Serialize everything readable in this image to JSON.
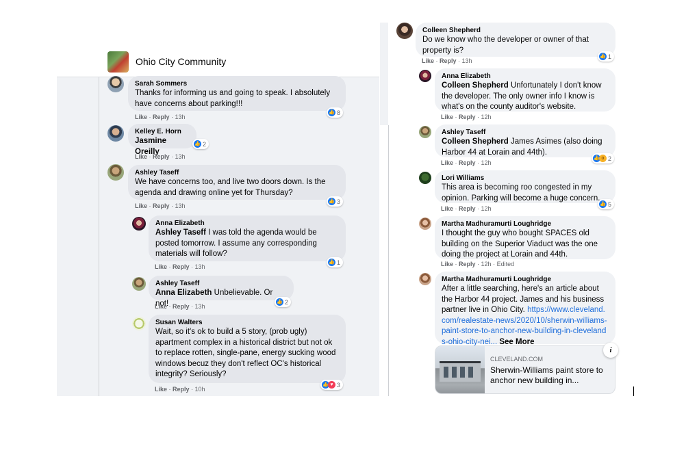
{
  "group": {
    "title": "Ohio City Community"
  },
  "left_comments": [
    {
      "author": "Sarah Sommers",
      "text": "Thanks for informing us and going to speak. I absolutely have concerns about parking!!!",
      "like": "Like",
      "reply": "Reply",
      "time": "13h",
      "reactions": "8"
    },
    {
      "author": "Kelley E. Horn",
      "tag": "Jasmine Oreilly",
      "like": "Like",
      "reply": "Reply",
      "time": "13h",
      "reactions": "2"
    },
    {
      "author": "Ashley Taseff",
      "text": "We have concerns too, and live two doors down. Is the agenda and drawing online yet for Thursday?",
      "like": "Like",
      "reply": "Reply",
      "time": "13h",
      "reactions": "3"
    },
    {
      "author": "Anna Elizabeth",
      "tag": "Ashley Taseff",
      "text": " I was told the agenda would be posted tomorrow. I assume any corresponding materials will follow?",
      "like": "Like",
      "reply": "Reply",
      "time": "13h",
      "reactions": "1"
    },
    {
      "author": "Ashley Taseff",
      "tag": "Anna Elizabeth",
      "text": " Unbelievable. Or not!",
      "like": "Like",
      "reply": "Reply",
      "time": "13h",
      "reactions": "2"
    },
    {
      "author": "Susan Walters",
      "text": "Wait, so it's ok to build a 5 story, (prob ugly) apartment complex in a historical district but not ok to replace rotten, single-pane, energy sucking wood windows becuz they don't reflect OC's historical integrity? Seriously?",
      "like": "Like",
      "reply": "Reply",
      "time": "10h",
      "reactions": "3"
    }
  ],
  "right_comments": [
    {
      "author": "Colleen Shepherd",
      "text": "Do we know who the developer or owner of that property is?",
      "like": "Like",
      "reply": "Reply",
      "time": "13h",
      "reactions": "1"
    },
    {
      "author": "Anna Elizabeth",
      "tag": "Colleen Shepherd",
      "text": " Unfortunately I don't know the developer. The only owner info I know is what's on the county auditor's website.",
      "like": "Like",
      "reply": "Reply",
      "time": "12h"
    },
    {
      "author": "Ashley Taseff",
      "tag": "Colleen Shepherd",
      "text": " James Asimes (also doing Harbor 44 at Lorain and 44th).",
      "like": "Like",
      "reply": "Reply",
      "time": "12h",
      "reactions": "2"
    },
    {
      "author": "Lori Williams",
      "text": "This area is becoming roo congested in my opinion. Parking will become a huge concern.",
      "like": "Like",
      "reply": "Reply",
      "time": "12h",
      "reactions": "5"
    },
    {
      "author": "Martha Madhuramurti Loughridge",
      "text": "I thought the guy who bought SPACES old building on the Superior Viaduct was the one doing the project at Lorain and 44th.",
      "like": "Like",
      "reply": "Reply",
      "time": "12h",
      "edited": "Edited"
    },
    {
      "author": "Martha Madhuramurti Loughridge",
      "text": "After a little searching, here's an article about the Harbor 44 project. James and his business partner live in Ohio City. ",
      "link": "https://www.cleveland.com/realestate-news/2020/10/sherwin-williams-paint-store-to-anchor-new-building-in-clevelands-ohio-city-nei...",
      "see_more": " See More"
    }
  ],
  "link_card": {
    "domain": "CLEVELAND.COM",
    "title": "Sherwin-Williams paint store to anchor new building in..."
  },
  "icons": {
    "info": "i"
  },
  "colors": {
    "link": "#216fdb",
    "like_blue": "#1877f2",
    "love_red": "#f33e58",
    "wow_yellow": "#f7b125",
    "bubble": "#f0f2f5",
    "meta": "#65676b"
  }
}
